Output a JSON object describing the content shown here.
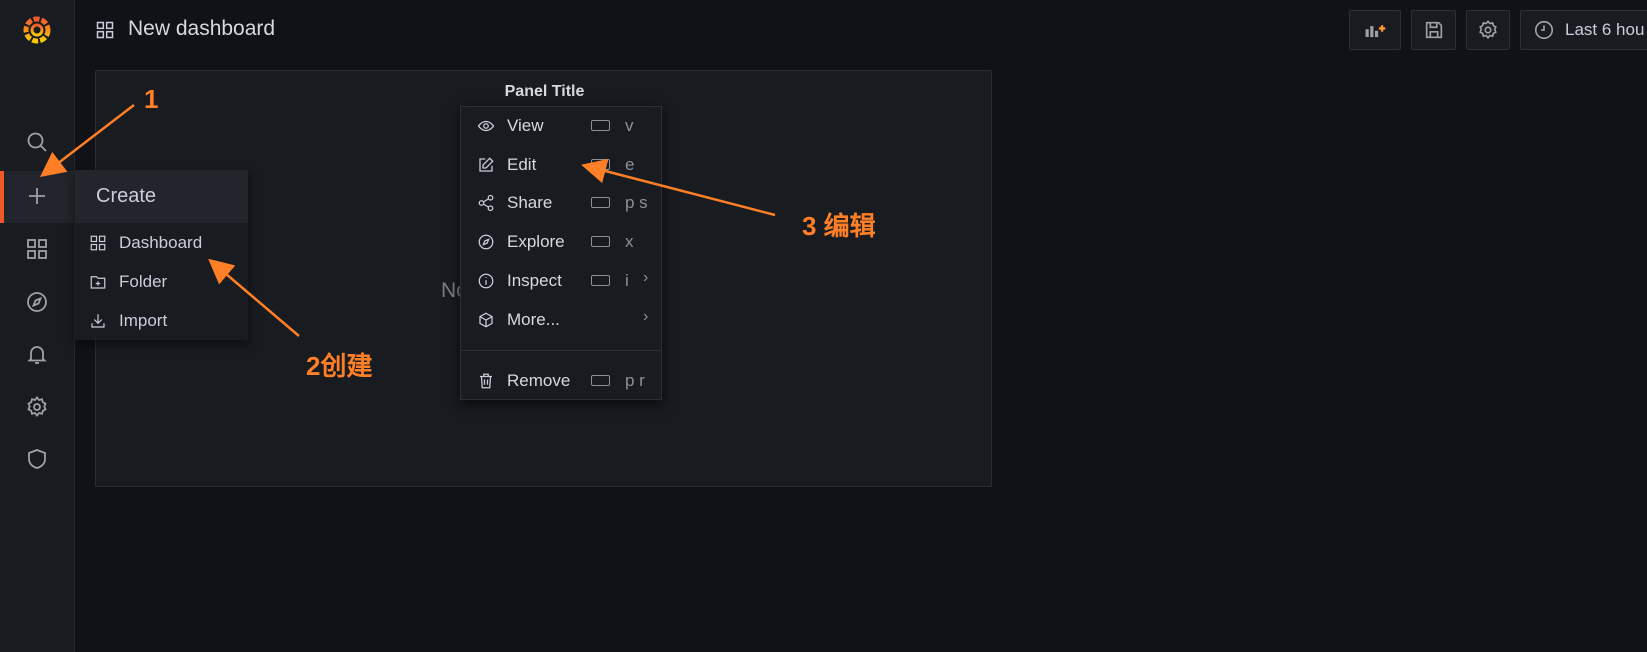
{
  "topbar": {
    "title": "New dashboard",
    "time_range": "Last 6 hou",
    "buttons": [
      "add-panel",
      "save",
      "settings",
      "time-picker"
    ]
  },
  "sidebar": {
    "items": [
      "search",
      "create",
      "dashboards",
      "explore",
      "alerting",
      "configuration",
      "server-admin"
    ]
  },
  "create_menu": {
    "header": "Create",
    "items": [
      {
        "label": "Dashboard",
        "icon": "apps-icon"
      },
      {
        "label": "Folder",
        "icon": "folder-plus-icon"
      },
      {
        "label": "Import",
        "icon": "import-icon"
      }
    ]
  },
  "panel": {
    "title": "Panel Title",
    "no_data": "No data"
  },
  "panel_menu": {
    "items": [
      {
        "label": "View",
        "shortcut": "v",
        "icon": "eye-icon"
      },
      {
        "label": "Edit",
        "shortcut": "e",
        "icon": "edit-icon"
      },
      {
        "label": "Share",
        "shortcut": "p s",
        "icon": "share-icon"
      },
      {
        "label": "Explore",
        "shortcut": "x",
        "icon": "compass-icon"
      },
      {
        "label": "Inspect",
        "shortcut": "i",
        "icon": "info-icon",
        "submenu": true
      },
      {
        "label": "More...",
        "shortcut": "",
        "icon": "cube-icon",
        "submenu": true
      }
    ],
    "remove": {
      "label": "Remove",
      "shortcut": "p r",
      "icon": "trash-icon"
    }
  },
  "annotations": {
    "step1": "1",
    "step2": "2创建",
    "step3": "3 编辑",
    "color": "#ff7f27"
  },
  "colors": {
    "background": "#111217",
    "sidebar": "#181b1f",
    "active": "#f05a28",
    "accent": "#ff7f27"
  }
}
